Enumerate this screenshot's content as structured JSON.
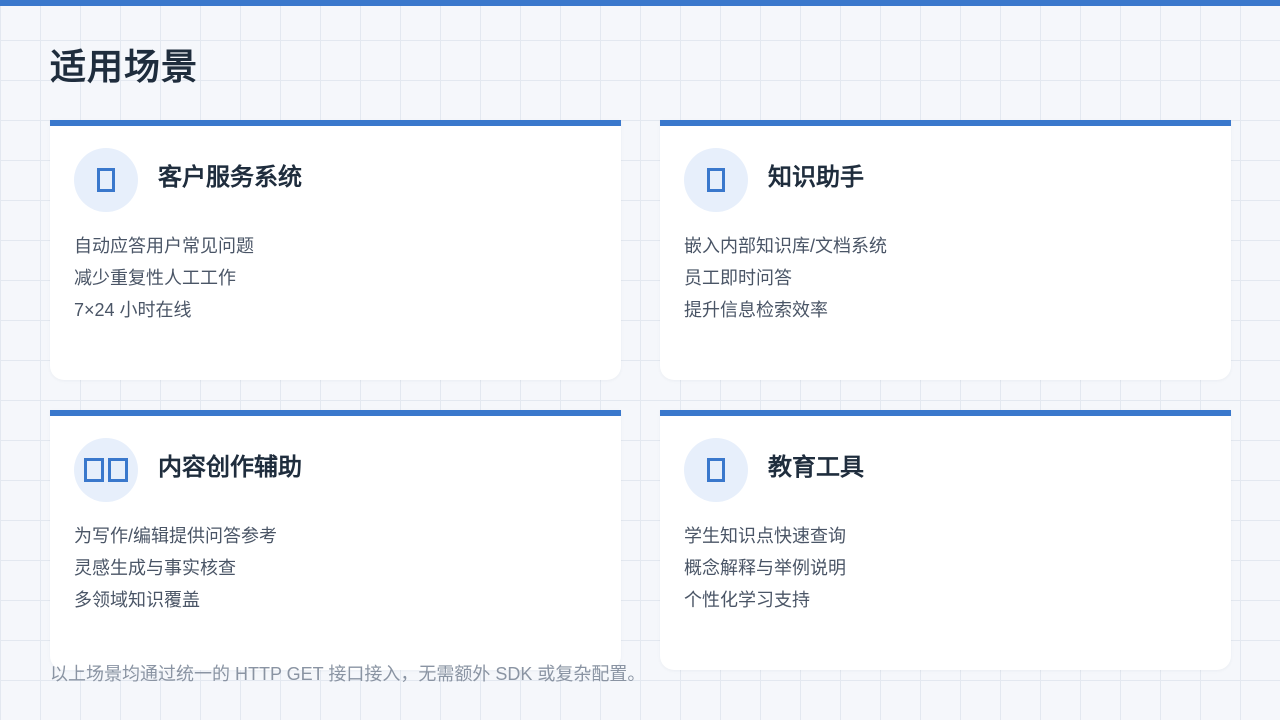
{
  "page": {
    "title": "适用场景",
    "accent_color": "#3a78cc",
    "icon_bg_color": "#e7effb"
  },
  "cards": [
    {
      "title": "客户服务系统",
      "icon": "missing-glyph-icon",
      "items": [
        "自动应答用户常见问题",
        "减少重复性人工工作",
        "7×24 小时在线"
      ]
    },
    {
      "title": "知识助手",
      "icon": "missing-glyph-icon",
      "items": [
        "嵌入内部知识库/文档系统",
        "员工即时问答",
        "提升信息检索效率"
      ]
    },
    {
      "title": "内容创作辅助",
      "icon": "missing-glyph-pair-icon",
      "items": [
        "为写作/编辑提供问答参考",
        "灵感生成与事实核查",
        "多领域知识覆盖"
      ]
    },
    {
      "title": "教育工具",
      "icon": "missing-glyph-icon",
      "items": [
        "学生知识点快速查询",
        "概念解释与举例说明",
        "个性化学习支持"
      ]
    }
  ],
  "footer": {
    "note": "以上场景均通过统一的 HTTP GET 接口接入，无需额外 SDK 或复杂配置。"
  }
}
